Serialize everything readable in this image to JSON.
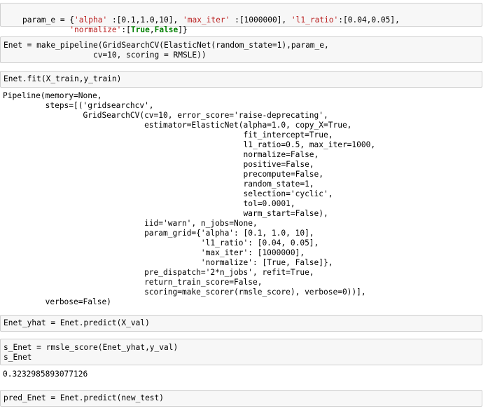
{
  "cells": [
    {
      "type": "code",
      "lines": [
        [
          {
            "text": "param_e = {",
            "style": ""
          },
          {
            "text": "'alpha'",
            "style": "str"
          },
          {
            "text": " :[0.1,1.0,10], ",
            "style": ""
          },
          {
            "text": "'max_iter'",
            "style": "str"
          },
          {
            "text": " :[1000000], ",
            "style": ""
          },
          {
            "text": "'l1_ratio'",
            "style": "str"
          },
          {
            "text": ":[0.04,0.05],",
            "style": ""
          }
        ],
        [
          {
            "text": "          ",
            "style": ""
          },
          {
            "text": "'normalize'",
            "style": "str"
          },
          {
            "text": ":[",
            "style": ""
          },
          {
            "text": "True",
            "style": "kw"
          },
          {
            "text": ",",
            "style": ""
          },
          {
            "text": "False",
            "style": "kw"
          },
          {
            "text": "]}",
            "style": ""
          }
        ]
      ]
    },
    {
      "type": "code",
      "lines": [
        [
          {
            "text": "Enet = make_pipeline(GridSearchCV(ElasticNet(random_state=1),param_e,",
            "style": ""
          }
        ],
        [
          {
            "text": "                   cv=10, scoring = RMSLE))",
            "style": ""
          }
        ]
      ]
    },
    {
      "type": "code",
      "lines": [
        [
          {
            "text": "Enet.fit(X_train,y_train)",
            "style": ""
          }
        ]
      ]
    },
    {
      "type": "output",
      "lines": [
        [
          {
            "text": "Pipeline(memory=None,",
            "style": ""
          }
        ],
        [
          {
            "text": "         steps=[('gridsearchcv',",
            "style": ""
          }
        ],
        [
          {
            "text": "                 GridSearchCV(cv=10, error_score='raise-deprecating',",
            "style": ""
          }
        ],
        [
          {
            "text": "                              estimator=ElasticNet(alpha=1.0, copy_X=True,",
            "style": ""
          }
        ],
        [
          {
            "text": "                                                   fit_intercept=True,",
            "style": ""
          }
        ],
        [
          {
            "text": "                                                   l1_ratio=0.5, max_iter=1000,",
            "style": ""
          }
        ],
        [
          {
            "text": "                                                   normalize=False,",
            "style": ""
          }
        ],
        [
          {
            "text": "                                                   positive=False,",
            "style": ""
          }
        ],
        [
          {
            "text": "                                                   precompute=False,",
            "style": ""
          }
        ],
        [
          {
            "text": "                                                   random_state=1,",
            "style": ""
          }
        ],
        [
          {
            "text": "                                                   selection='cyclic',",
            "style": ""
          }
        ],
        [
          {
            "text": "                                                   tol=0.0001,",
            "style": ""
          }
        ],
        [
          {
            "text": "                                                   warm_start=False),",
            "style": ""
          }
        ],
        [
          {
            "text": "                              iid='warn', n_jobs=None,",
            "style": ""
          }
        ],
        [
          {
            "text": "                              param_grid={'alpha': [0.1, 1.0, 10],",
            "style": ""
          }
        ],
        [
          {
            "text": "                                          'l1_ratio': [0.04, 0.05],",
            "style": ""
          }
        ],
        [
          {
            "text": "                                          'max_iter': [1000000],",
            "style": ""
          }
        ],
        [
          {
            "text": "                                          'normalize': [True, False]},",
            "style": ""
          }
        ],
        [
          {
            "text": "                              pre_dispatch='2*n_jobs', refit=True,",
            "style": ""
          }
        ],
        [
          {
            "text": "                              return_train_score=False,",
            "style": ""
          }
        ],
        [
          {
            "text": "                              scoring=make_scorer(rmsle_score), verbose=0))],",
            "style": ""
          }
        ],
        [
          {
            "text": "         verbose=False)",
            "style": ""
          }
        ]
      ]
    },
    {
      "type": "code",
      "lines": [
        [
          {
            "text": "Enet_yhat = Enet.predict(X_val)",
            "style": ""
          }
        ]
      ]
    },
    {
      "type": "code",
      "lines": [
        [
          {
            "text": "s_Enet = rmsle_score(Enet_yhat,y_val)",
            "style": ""
          }
        ],
        [
          {
            "text": "s_Enet",
            "style": ""
          }
        ]
      ]
    },
    {
      "type": "output",
      "lines": [
        [
          {
            "text": "0.3232985893077126",
            "style": ""
          }
        ]
      ]
    },
    {
      "type": "code",
      "lines": [
        [
          {
            "text": "pred_Enet = Enet.predict(new_test)",
            "style": ""
          }
        ]
      ]
    }
  ]
}
